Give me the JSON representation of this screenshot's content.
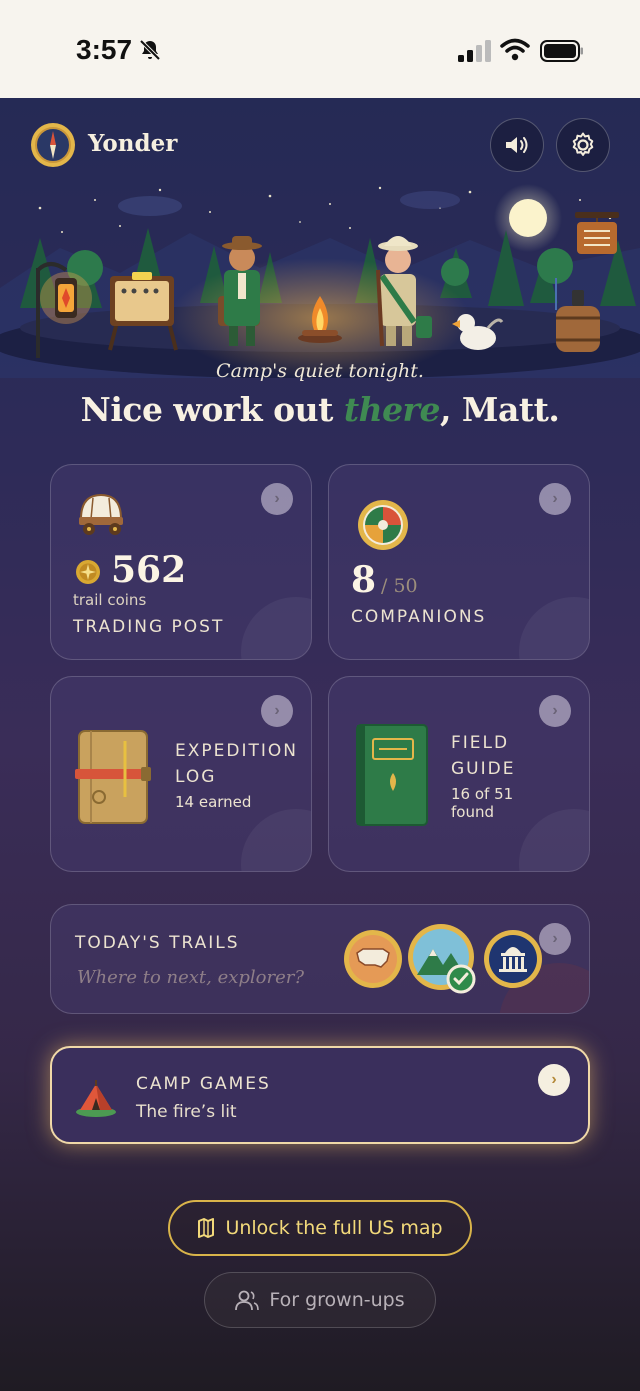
{
  "status_bar": {
    "time": "3:57",
    "icons": [
      "bell-slash-icon",
      "signal-icon",
      "wifi-icon",
      "battery-icon"
    ]
  },
  "header": {
    "app_name": "Yonder",
    "logo_icon": "compass-icon",
    "buttons": [
      "sound-icon",
      "gear-icon"
    ]
  },
  "hero": {
    "tagline": "Camp's quiet tonight.",
    "headline_pre": "Nice work out ",
    "headline_accent": "there",
    "headline_post": ", Matt."
  },
  "cards": {
    "trading_post": {
      "icon": "covered-wagon-icon",
      "coin_icon": "coin-icon",
      "coins": "562",
      "coins_label": "trail coins",
      "title": "TRADING POST"
    },
    "companions": {
      "icon": "crest-badge-icon",
      "count": "8",
      "total": "/ 50",
      "title": "COMPANIONS"
    },
    "expedition_log": {
      "icon": "journal-icon",
      "title_line1": "EXPEDITION",
      "title_line2": "LOG",
      "sub": "14 earned"
    },
    "field_guide": {
      "icon": "green-book-icon",
      "title_line1": "FIELD",
      "title_line2": "GUIDE",
      "sub_line1": "16 of 51",
      "sub_line2": "found"
    },
    "todays_trails": {
      "title": "TODAY'S TRAILS",
      "subtitle": "Where to next, explorer?",
      "badges": [
        "us-map-badge-icon",
        "mountain-badge-icon",
        "capitol-badge-icon"
      ]
    },
    "camp_games": {
      "icon": "tent-icon",
      "title": "CAMP GAMES",
      "sub": "The fire’s lit"
    }
  },
  "footer": {
    "unlock_label": "Unlock the full US map",
    "grownups_label": "For grown-ups"
  },
  "colors": {
    "accent_green": "#3f8a52",
    "gold": "#d9b44a",
    "cream": "#f8f1e2"
  }
}
